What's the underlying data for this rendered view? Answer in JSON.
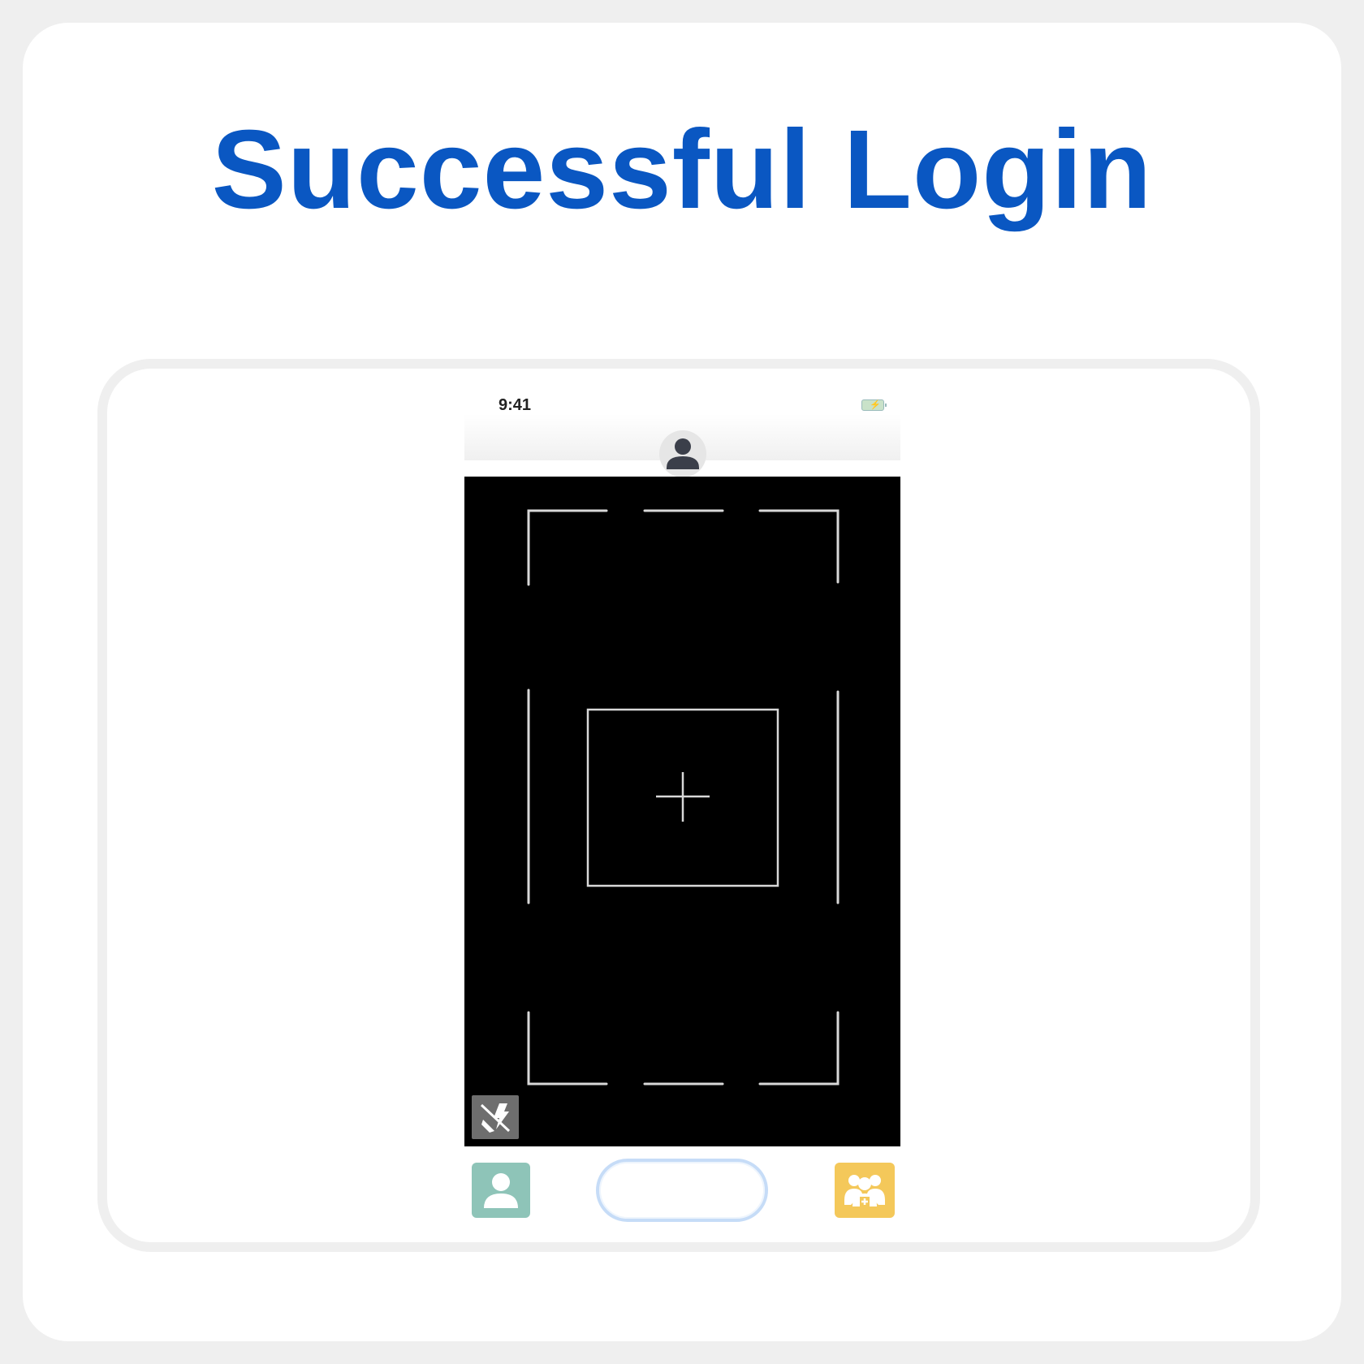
{
  "page": {
    "title": "Successful Login"
  },
  "status_bar": {
    "time": "9:41",
    "battery_icon": "battery-charging-icon"
  },
  "header": {
    "avatar_icon": "user-avatar-icon"
  },
  "camera": {
    "viewfinder_icon": "crosshair-icon",
    "flash_icon": "flash-off-icon"
  },
  "bottom_bar": {
    "profile_icon": "user-icon",
    "capture_icon": "capture-button",
    "group_icon": "group-add-icon"
  },
  "colors": {
    "title": "#0a57c2",
    "profile_button": "#8ec4b8",
    "group_button": "#f4c85a",
    "capture_border": "#c6dcf7",
    "viewfinder": "#000000"
  }
}
